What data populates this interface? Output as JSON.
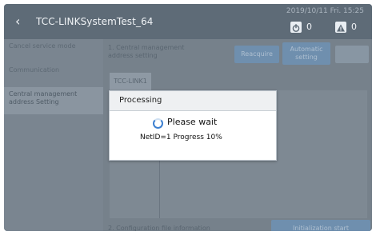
{
  "header": {
    "title": "TCC-LINKSystemTest_64",
    "datetime": "2019/10/11 Fri. 15:25",
    "power_count": "0",
    "warning_count": "0"
  },
  "sidebar": {
    "items": [
      {
        "label": "Cancel service mode"
      },
      {
        "label": "Communication"
      },
      {
        "label": "Central management address Setting"
      }
    ]
  },
  "main": {
    "section1_label": "1. Central management address setting",
    "reacquire_label": "Reacquire",
    "automatic_label": "Automatic setting",
    "tab_label": "TCC-LINK1",
    "section2_label": "2. Configuration file information",
    "init_label": "Initialization start"
  },
  "dialog": {
    "title": "Processing",
    "message": "Please wait",
    "progress_text": "NetID=1  Progress 10%"
  },
  "icons": {
    "back": "chevron-left-icon",
    "power": "power-icon",
    "warning": "warning-icon",
    "spinner": "loading-spinner-icon"
  },
  "colors": {
    "header_bg": "#5e6b77",
    "overlay_bg": "#7f8a94",
    "button_bg": "#6f8fae",
    "spinner": "#3c7fd0"
  }
}
